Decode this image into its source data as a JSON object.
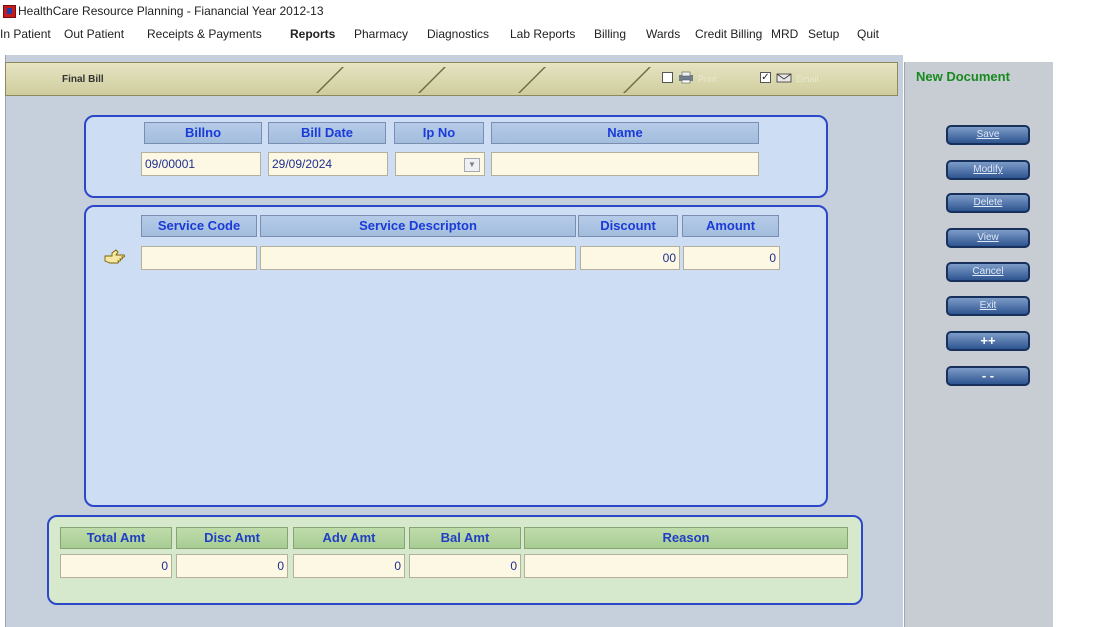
{
  "window": {
    "title": "HealthCare Resource Planning - Fianancial Year 2012-13"
  },
  "menu": [
    "In Patient",
    "Out Patient",
    "Receipts & Payments",
    "Reports",
    "Pharmacy",
    "Diagnostics",
    "Lab Reports",
    "Billing",
    "Wards",
    "Credit Billing",
    "MRD",
    "Setup",
    "Quit"
  ],
  "form": {
    "title": "Final Bill",
    "print_label": "Print",
    "email_label": "Email",
    "email_checked": "✓"
  },
  "status": {
    "new_document": "New Document"
  },
  "bill": {
    "headers": {
      "billno": "Billno",
      "bill_date": "Bill Date",
      "ip_no": "Ip No",
      "name": "Name"
    },
    "values": {
      "billno": "09/00001",
      "bill_date": "29/09/2024",
      "ip_no": "",
      "name": ""
    }
  },
  "services": {
    "headers": {
      "code": "Service Code",
      "desc": "Service Descripton",
      "discount": "Discount",
      "amount": "Amount"
    },
    "row": {
      "code": "",
      "desc": "",
      "discount": "00",
      "amount": "0"
    }
  },
  "totals": {
    "headers": {
      "total": "Total Amt",
      "disc": "Disc Amt",
      "adv": "Adv Amt",
      "bal": "Bal Amt",
      "reason": "Reason"
    },
    "values": {
      "total": "0",
      "disc": "0",
      "adv": "0",
      "bal": "0",
      "reason": ""
    }
  },
  "buttons": {
    "save": "Save",
    "modify": "Modify",
    "delete": "Delete",
    "view": "View",
    "cancel": "Cancel",
    "exit": "Exit",
    "add_row": "++",
    "remove_row": "- -"
  }
}
